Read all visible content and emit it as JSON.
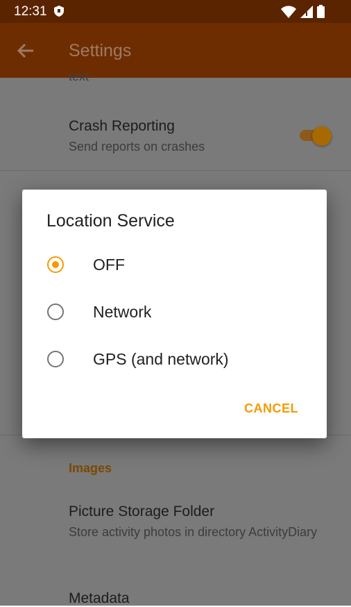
{
  "status_bar": {
    "time": "12:31"
  },
  "app_bar": {
    "title": "Settings"
  },
  "settings": {
    "cut_text": "text",
    "crash_reporting": {
      "title": "Crash Reporting",
      "summary": "Send reports on crashes",
      "enabled": true
    },
    "images_category": "Images",
    "picture_storage": {
      "title": "Picture Storage Folder",
      "summary": "Store activity photos in directory ActivityDiary"
    },
    "metadata": {
      "title": "Metadata"
    }
  },
  "dialog": {
    "title": "Location Service",
    "options": [
      {
        "label": "OFF",
        "selected": true
      },
      {
        "label": "Network",
        "selected": false
      },
      {
        "label": "GPS (and network)",
        "selected": false
      }
    ],
    "cancel_label": "CANCEL"
  },
  "colors": {
    "accent": "#f59b00",
    "app_bar": "#6e2d00",
    "status_bar": "#5a2400"
  },
  "icons": [
    "shield-icon",
    "wifi-icon",
    "signal-icon",
    "battery-icon",
    "back-arrow-icon"
  ]
}
